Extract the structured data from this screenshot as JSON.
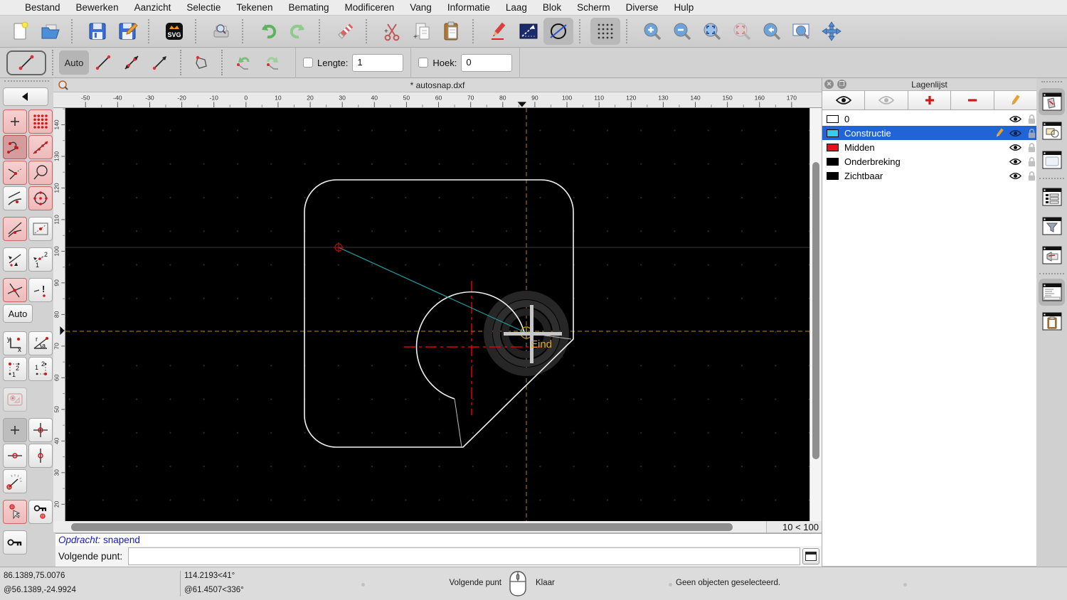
{
  "menubar": {
    "items": [
      "Bestand",
      "Bewerken",
      "Aanzicht",
      "Selectie",
      "Tekenen",
      "Bemating",
      "Modificeren",
      "Vang",
      "Informatie",
      "Laag",
      "Blok",
      "Scherm",
      "Diverse",
      "Hulp"
    ]
  },
  "toolbar": {
    "icons": [
      "new-document",
      "open-file",
      "save",
      "save-as",
      "svg-export",
      "print-preview",
      "undo",
      "redo",
      "delete",
      "cut",
      "copy",
      "paste",
      "draw-pencil",
      "ortho-restrict",
      "isometric-view",
      "grid-toggle",
      "zoom-in",
      "zoom-out",
      "zoom-auto",
      "zoom-selection",
      "zoom-previous",
      "zoom-window",
      "pan"
    ]
  },
  "options": {
    "current_tool": "line-two-points",
    "auto_label": "Auto",
    "lengte_label": "Lengte:",
    "lengte_value": "1",
    "lengte_checked": false,
    "hoek_label": "Hoek:",
    "hoek_value": "0",
    "hoek_checked": false
  },
  "snapbar": {
    "back": "◀",
    "auto_label": "Auto",
    "icons": [
      "snap-free",
      "snap-grid",
      "snap-endpoints",
      "snap-on-entity",
      "snap-perpendicular",
      "snap-distance",
      "snap-nearest",
      "snap-center",
      "snap-tangential",
      "snap-middle",
      "snap-reference",
      "snap-distance-12",
      "snap-intersection",
      "restrict-off",
      "coords-cartesian",
      "coords-polar",
      "corner-12-a",
      "corner-12-b",
      "cam-tool",
      "restrict-nothing",
      "restrict-orthogonal",
      "restrict-horizontal",
      "restrict-vertical",
      "angle-gauge",
      "set-relative-zero",
      "lock-relative-zero-target",
      "lock-relative-zero"
    ]
  },
  "canvas": {
    "title": "* autosnap.dxf",
    "snap_label": "Eind",
    "scale_label": "10 < 100",
    "h_ticks": [
      -50,
      -40,
      -30,
      -20,
      -10,
      0,
      10,
      20,
      30,
      40,
      50,
      60,
      70,
      80,
      90,
      100,
      110,
      120,
      130,
      140,
      150,
      160,
      170
    ],
    "v_ticks": [
      140,
      130,
      120,
      110,
      100,
      90,
      80,
      70,
      60,
      50,
      40,
      30,
      20
    ]
  },
  "layers": {
    "title": "Lagenlijst",
    "toolbar_icons": [
      "show-all-layers",
      "hide-all-layers",
      "add-layer",
      "remove-layer",
      "edit-layer"
    ],
    "rows": [
      {
        "name": "0",
        "color": "#ffffff",
        "selected": false,
        "editing": false,
        "visible": true,
        "locked": false
      },
      {
        "name": "Constructie",
        "color": "#35cdea",
        "selected": true,
        "editing": true,
        "visible": true,
        "locked": false
      },
      {
        "name": "Midden",
        "color": "#e8101c",
        "selected": false,
        "editing": false,
        "visible": true,
        "locked": false
      },
      {
        "name": "Onderbreking",
        "color": "#000000",
        "selected": false,
        "editing": false,
        "visible": true,
        "locked": false
      },
      {
        "name": "Zichtbaar",
        "color": "#000000",
        "selected": false,
        "editing": false,
        "visible": true,
        "locked": false
      }
    ]
  },
  "dock": {
    "icons": [
      "layer-list-dock",
      "block-list-dock",
      "library-browser-dock",
      "pen-list-dock",
      "filter-dock",
      "hatch-dock",
      "command-line-dock",
      "clipboard-dock"
    ]
  },
  "command": {
    "history_prefix": "Opdracht:",
    "history_text": " snapend",
    "prompt": "Volgende punt:"
  },
  "statusbar": {
    "abs_coord": "86.1389,75.0076",
    "rel_coord": "@56.1389,-24.9924",
    "polar_abs": "114.2193<41°",
    "polar_rel": "@61.4507<336°",
    "left_button_action": "Volgende punt",
    "right_button_action": "Klaar",
    "selection_status": "Geen objecten geselecteerd."
  },
  "colors": {
    "selection_blue": "#2264d8",
    "construction_cyan": "#35cdea",
    "layer_red": "#e8101c",
    "snap_label_gold": "#e2a81c",
    "preview_teal": "#1f9e9e",
    "construction_line_gold": "#8f6f14",
    "centerline_red": "#ff0000"
  }
}
